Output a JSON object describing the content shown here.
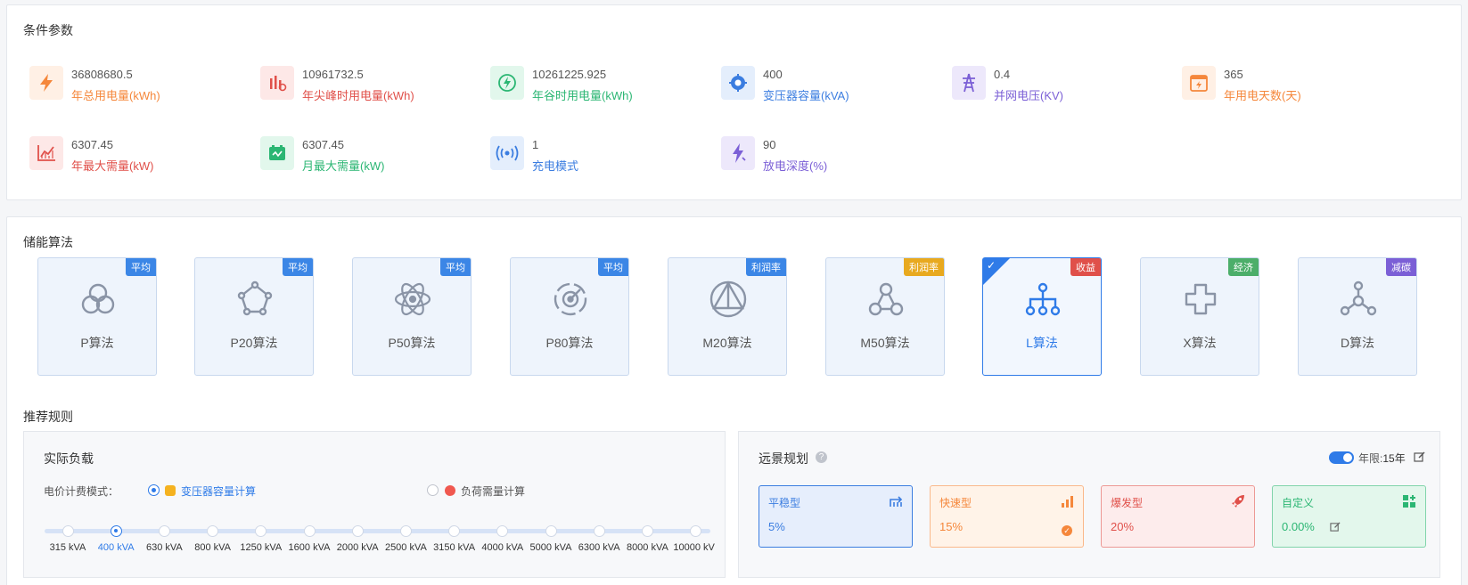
{
  "conditions": {
    "title": "条件参数",
    "items": [
      {
        "value": "36808680.5",
        "label": "年总用电量(kWh)",
        "icon": "lightning-icon",
        "color": "#f5873b",
        "bg": "#fff0e5"
      },
      {
        "value": "10961732.5",
        "label": "年尖峰时用电量(kWh)",
        "icon": "peak-bars-icon",
        "color": "#e0504a",
        "bg": "#fde8e7"
      },
      {
        "value": "10261225.925",
        "label": "年谷时用电量(kWh)",
        "icon": "charging-icon",
        "color": "#2bb673",
        "bg": "#e2f7ec"
      },
      {
        "value": "400",
        "label": "变压器容量(kVA)",
        "icon": "transformer-icon",
        "color": "#3b7de0",
        "bg": "#e4eefc"
      },
      {
        "value": "0.4",
        "label": "并网电压(KV)",
        "icon": "power-tower-icon",
        "color": "#7b5fd6",
        "bg": "#ede8fb"
      },
      {
        "value": "365",
        "label": "年用电天数(天)",
        "icon": "calendar-power-icon",
        "color": "#f5873b",
        "bg": "#fff0e5"
      },
      {
        "value": "6307.45",
        "label": "年最大需量(kW)",
        "icon": "line-chart-icon",
        "color": "#e0504a",
        "bg": "#fde8e7"
      },
      {
        "value": "6307.45",
        "label": "月最大需量(kW)",
        "icon": "battery-icon",
        "color": "#2bb673",
        "bg": "#e2f7ec"
      },
      {
        "value": "1",
        "label": "充电模式",
        "icon": "signal-icon",
        "color": "#3b7de0",
        "bg": "#e4eefc"
      },
      {
        "value": "90",
        "label": "放电深度(%)",
        "icon": "discharge-icon",
        "color": "#7b5fd6",
        "bg": "#ede8fb"
      }
    ]
  },
  "algorithms": {
    "title": "储能算法",
    "items": [
      {
        "name": "P算法",
        "badge": "平均",
        "badge_color": "#3b86e6",
        "icon": "circles-icon"
      },
      {
        "name": "P20算法",
        "badge": "平均",
        "badge_color": "#3b86e6",
        "icon": "pentagon-icon"
      },
      {
        "name": "P50算法",
        "badge": "平均",
        "badge_color": "#3b86e6",
        "icon": "atom-icon"
      },
      {
        "name": "P80算法",
        "badge": "平均",
        "badge_color": "#3b86e6",
        "icon": "target-icon"
      },
      {
        "name": "M20算法",
        "badge": "利润率",
        "badge_color": "#3b86e6",
        "icon": "triangle-network-icon"
      },
      {
        "name": "M50算法",
        "badge": "利润率",
        "badge_color": "#e8a91f",
        "icon": "three-nodes-icon"
      },
      {
        "name": "L算法",
        "badge": "收益",
        "badge_color": "#e0504a",
        "icon": "hierarchy-icon",
        "selected": true
      },
      {
        "name": "X算法",
        "badge": "经济",
        "badge_color": "#4cae6a",
        "icon": "cross-loop-icon"
      },
      {
        "name": "D算法",
        "badge": "减碳",
        "badge_color": "#7b5fd6",
        "icon": "molecule-icon"
      }
    ]
  },
  "rules": {
    "title": "推荐规则",
    "actual_load": {
      "title": "实际负载",
      "mode_label": "电价计费模式：",
      "options": [
        {
          "label": "变压器容量计算",
          "selected": true
        },
        {
          "label": "负荷需量计算",
          "selected": false
        }
      ],
      "slider_values": [
        "315 kVA",
        "400 kVA",
        "630 kVA",
        "800 kVA",
        "1250 kVA",
        "1600 kVA",
        "2000 kVA",
        "2500 kVA",
        "3150 kVA",
        "4000 kVA",
        "5000 kVA",
        "6300 kVA",
        "8000 kVA",
        "10000 kV"
      ],
      "slider_selected_index": 1
    },
    "outlook": {
      "title": "远景规划",
      "help_icon": "question-icon",
      "toggle_on": true,
      "year_label": "年限:",
      "year_value": "15年",
      "plans": [
        {
          "name": "平稳型",
          "value": "5%",
          "color": "#3b7de0",
          "bg": "#e6eefc",
          "icon": "steady-icon",
          "selected": true
        },
        {
          "name": "快速型",
          "value": "15%",
          "color": "#f5873b",
          "bg": "#fff3e8",
          "icon": "bars-up-icon"
        },
        {
          "name": "爆发型",
          "value": "20%",
          "color": "#e0504a",
          "bg": "#fdecec",
          "icon": "rocket-icon"
        },
        {
          "name": "自定义",
          "value": "0.00%",
          "color": "#2bb673",
          "bg": "#e3f7ec",
          "icon": "grid-plus-icon"
        }
      ]
    }
  }
}
